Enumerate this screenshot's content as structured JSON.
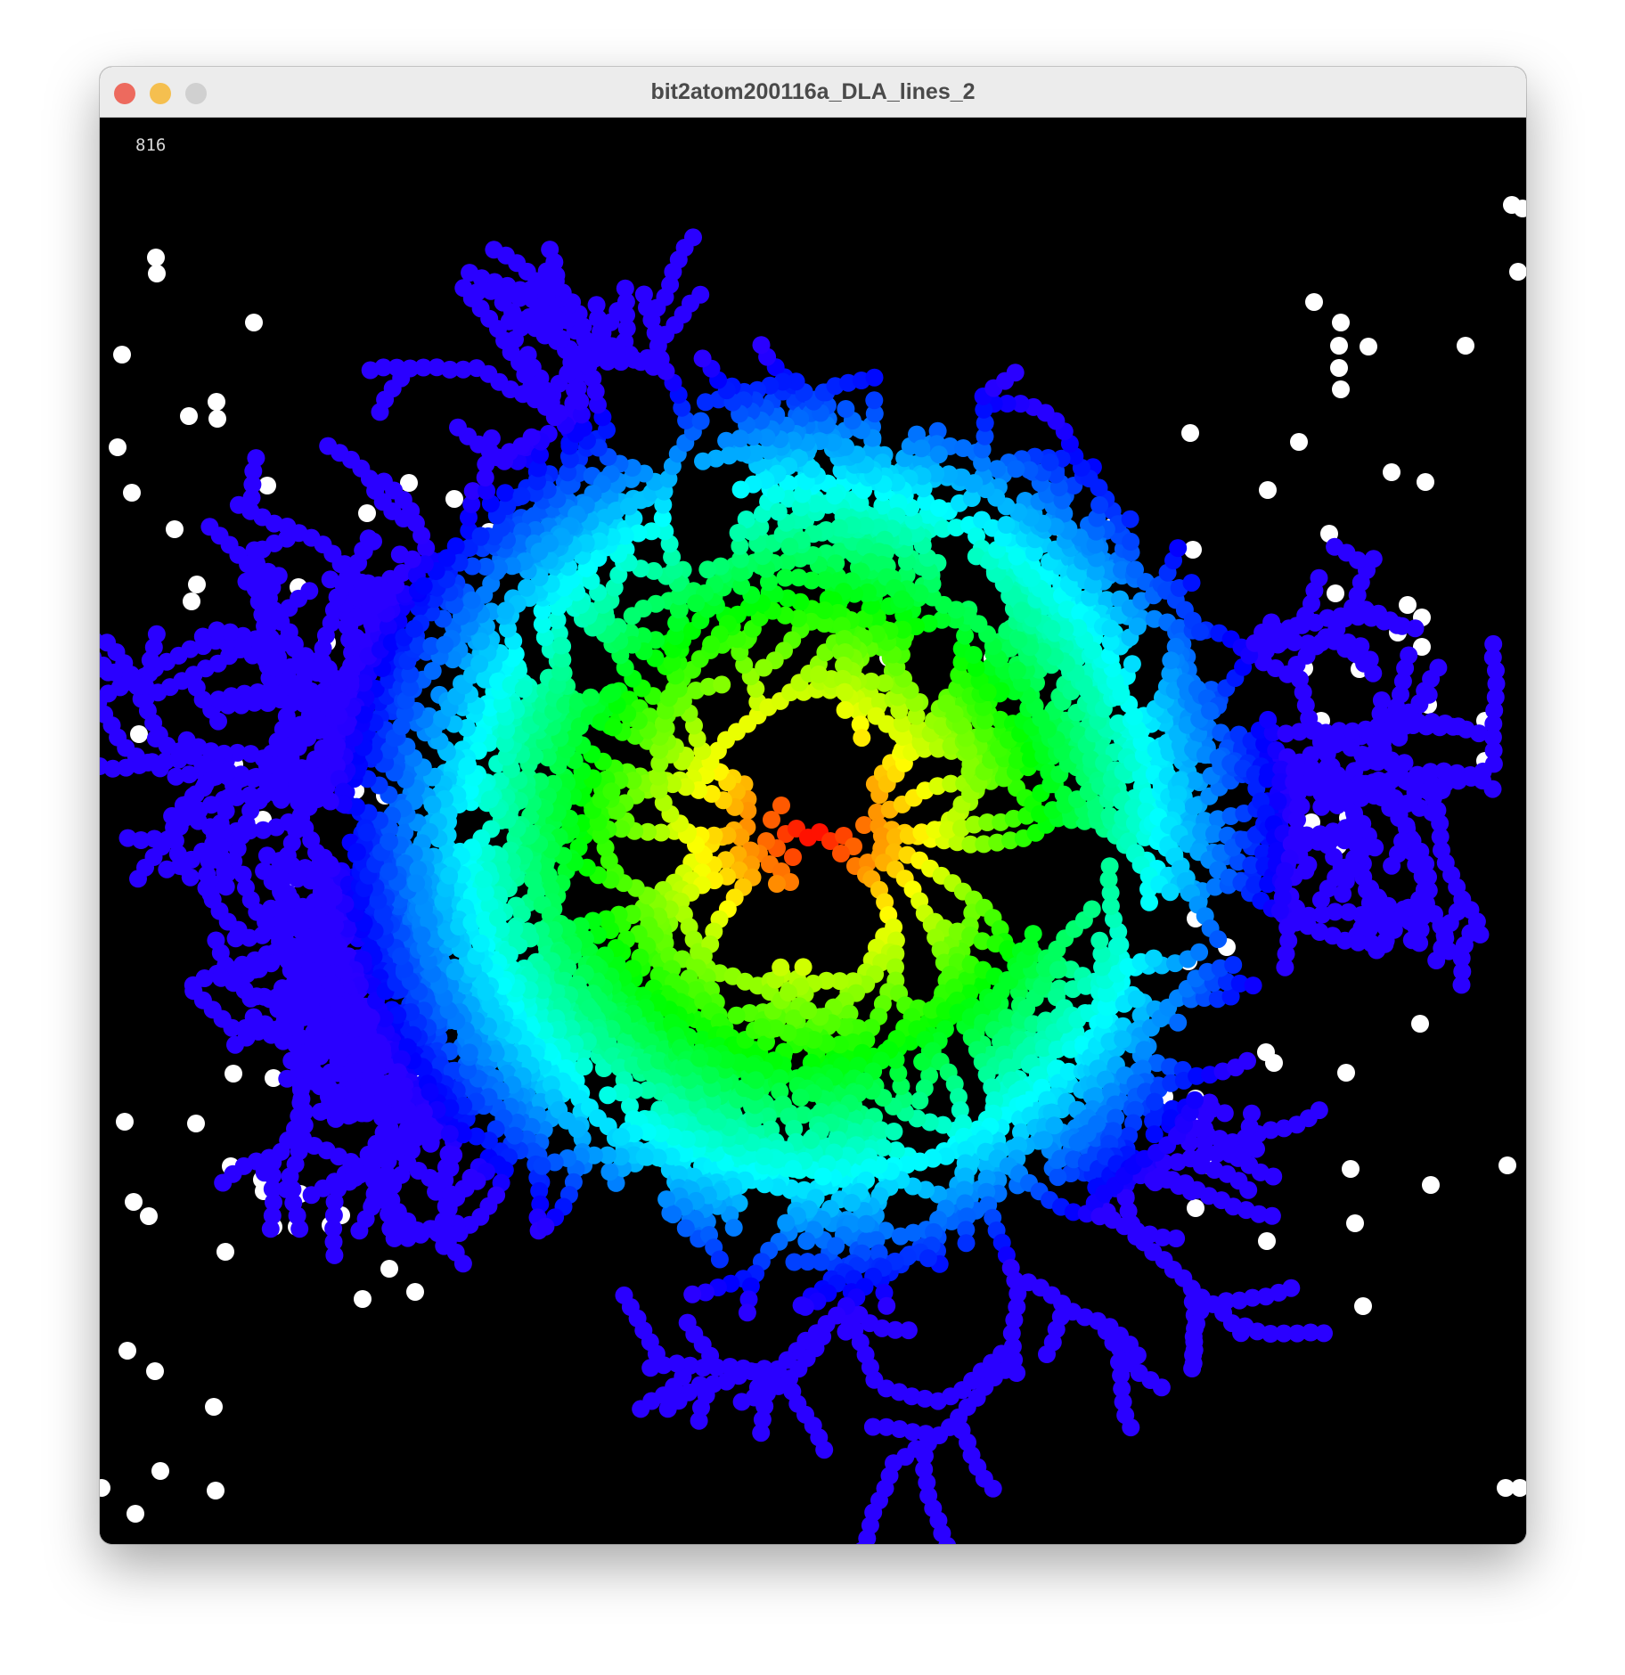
{
  "window": {
    "title": "bit2atom200116a_DLA_lines_2",
    "buttons": {
      "close_color": "#ed6a5e",
      "minimize_color": "#f5bf4f",
      "zoom_color": "#d0d0d0"
    }
  },
  "sketch": {
    "counter": "816",
    "background": "#000000",
    "walker_color": "#ffffff",
    "cluster_palette": "hue gradient: red at center → orange → yellow → green → cyan → blue at branch tips"
  }
}
